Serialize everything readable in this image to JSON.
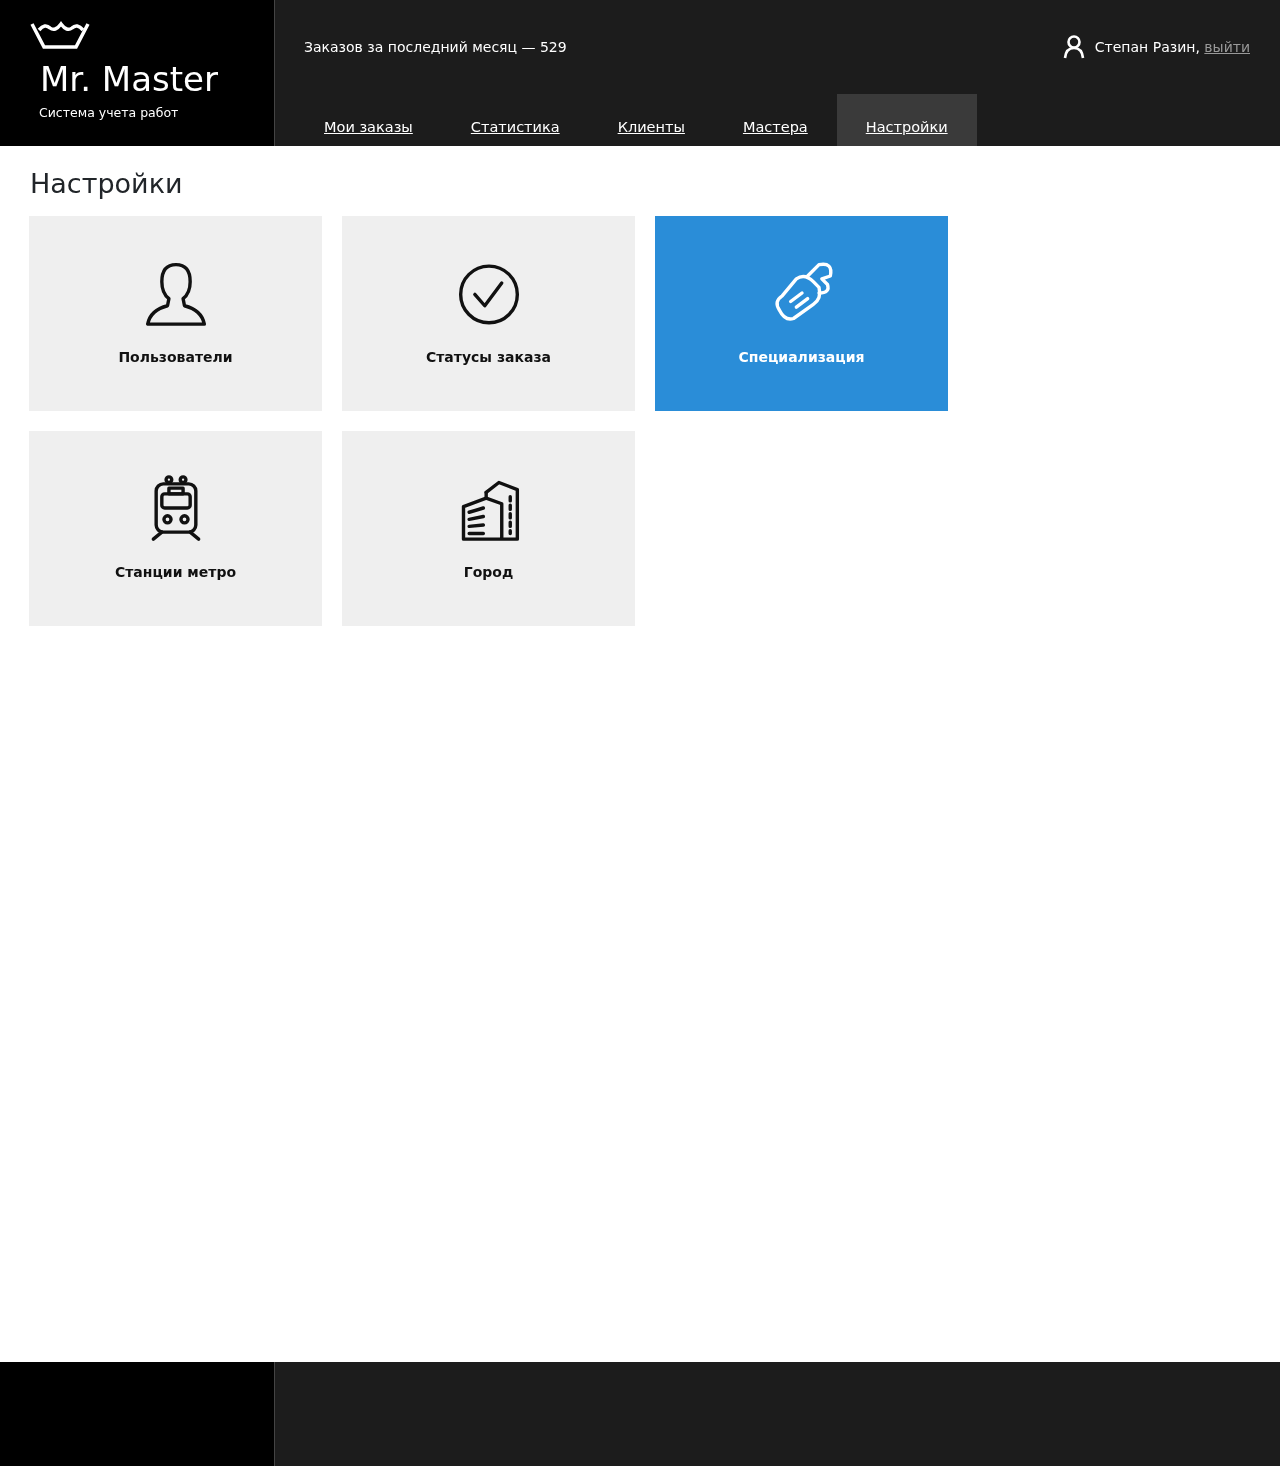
{
  "brand": {
    "name": "Mr. Master",
    "tagline": "Система учета работ"
  },
  "header": {
    "stats": "Заказов за последний месяц — 529",
    "user": "Степан Разин,",
    "logout": "выйти"
  },
  "nav": [
    {
      "label": "Мои заказы",
      "selected": false
    },
    {
      "label": "Статистика",
      "selected": false
    },
    {
      "label": "Клиенты",
      "selected": false
    },
    {
      "label": "Мастера",
      "selected": false
    },
    {
      "label": "Настройки",
      "selected": true
    }
  ],
  "page_title": "Настройки",
  "tiles": [
    {
      "label": "Пользователи",
      "selected": false
    },
    {
      "label": "Статусы заказа",
      "selected": false
    },
    {
      "label": "Специализация",
      "selected": true
    },
    {
      "label": "Станции метро",
      "selected": false
    },
    {
      "label": "Город",
      "selected": false
    }
  ]
}
